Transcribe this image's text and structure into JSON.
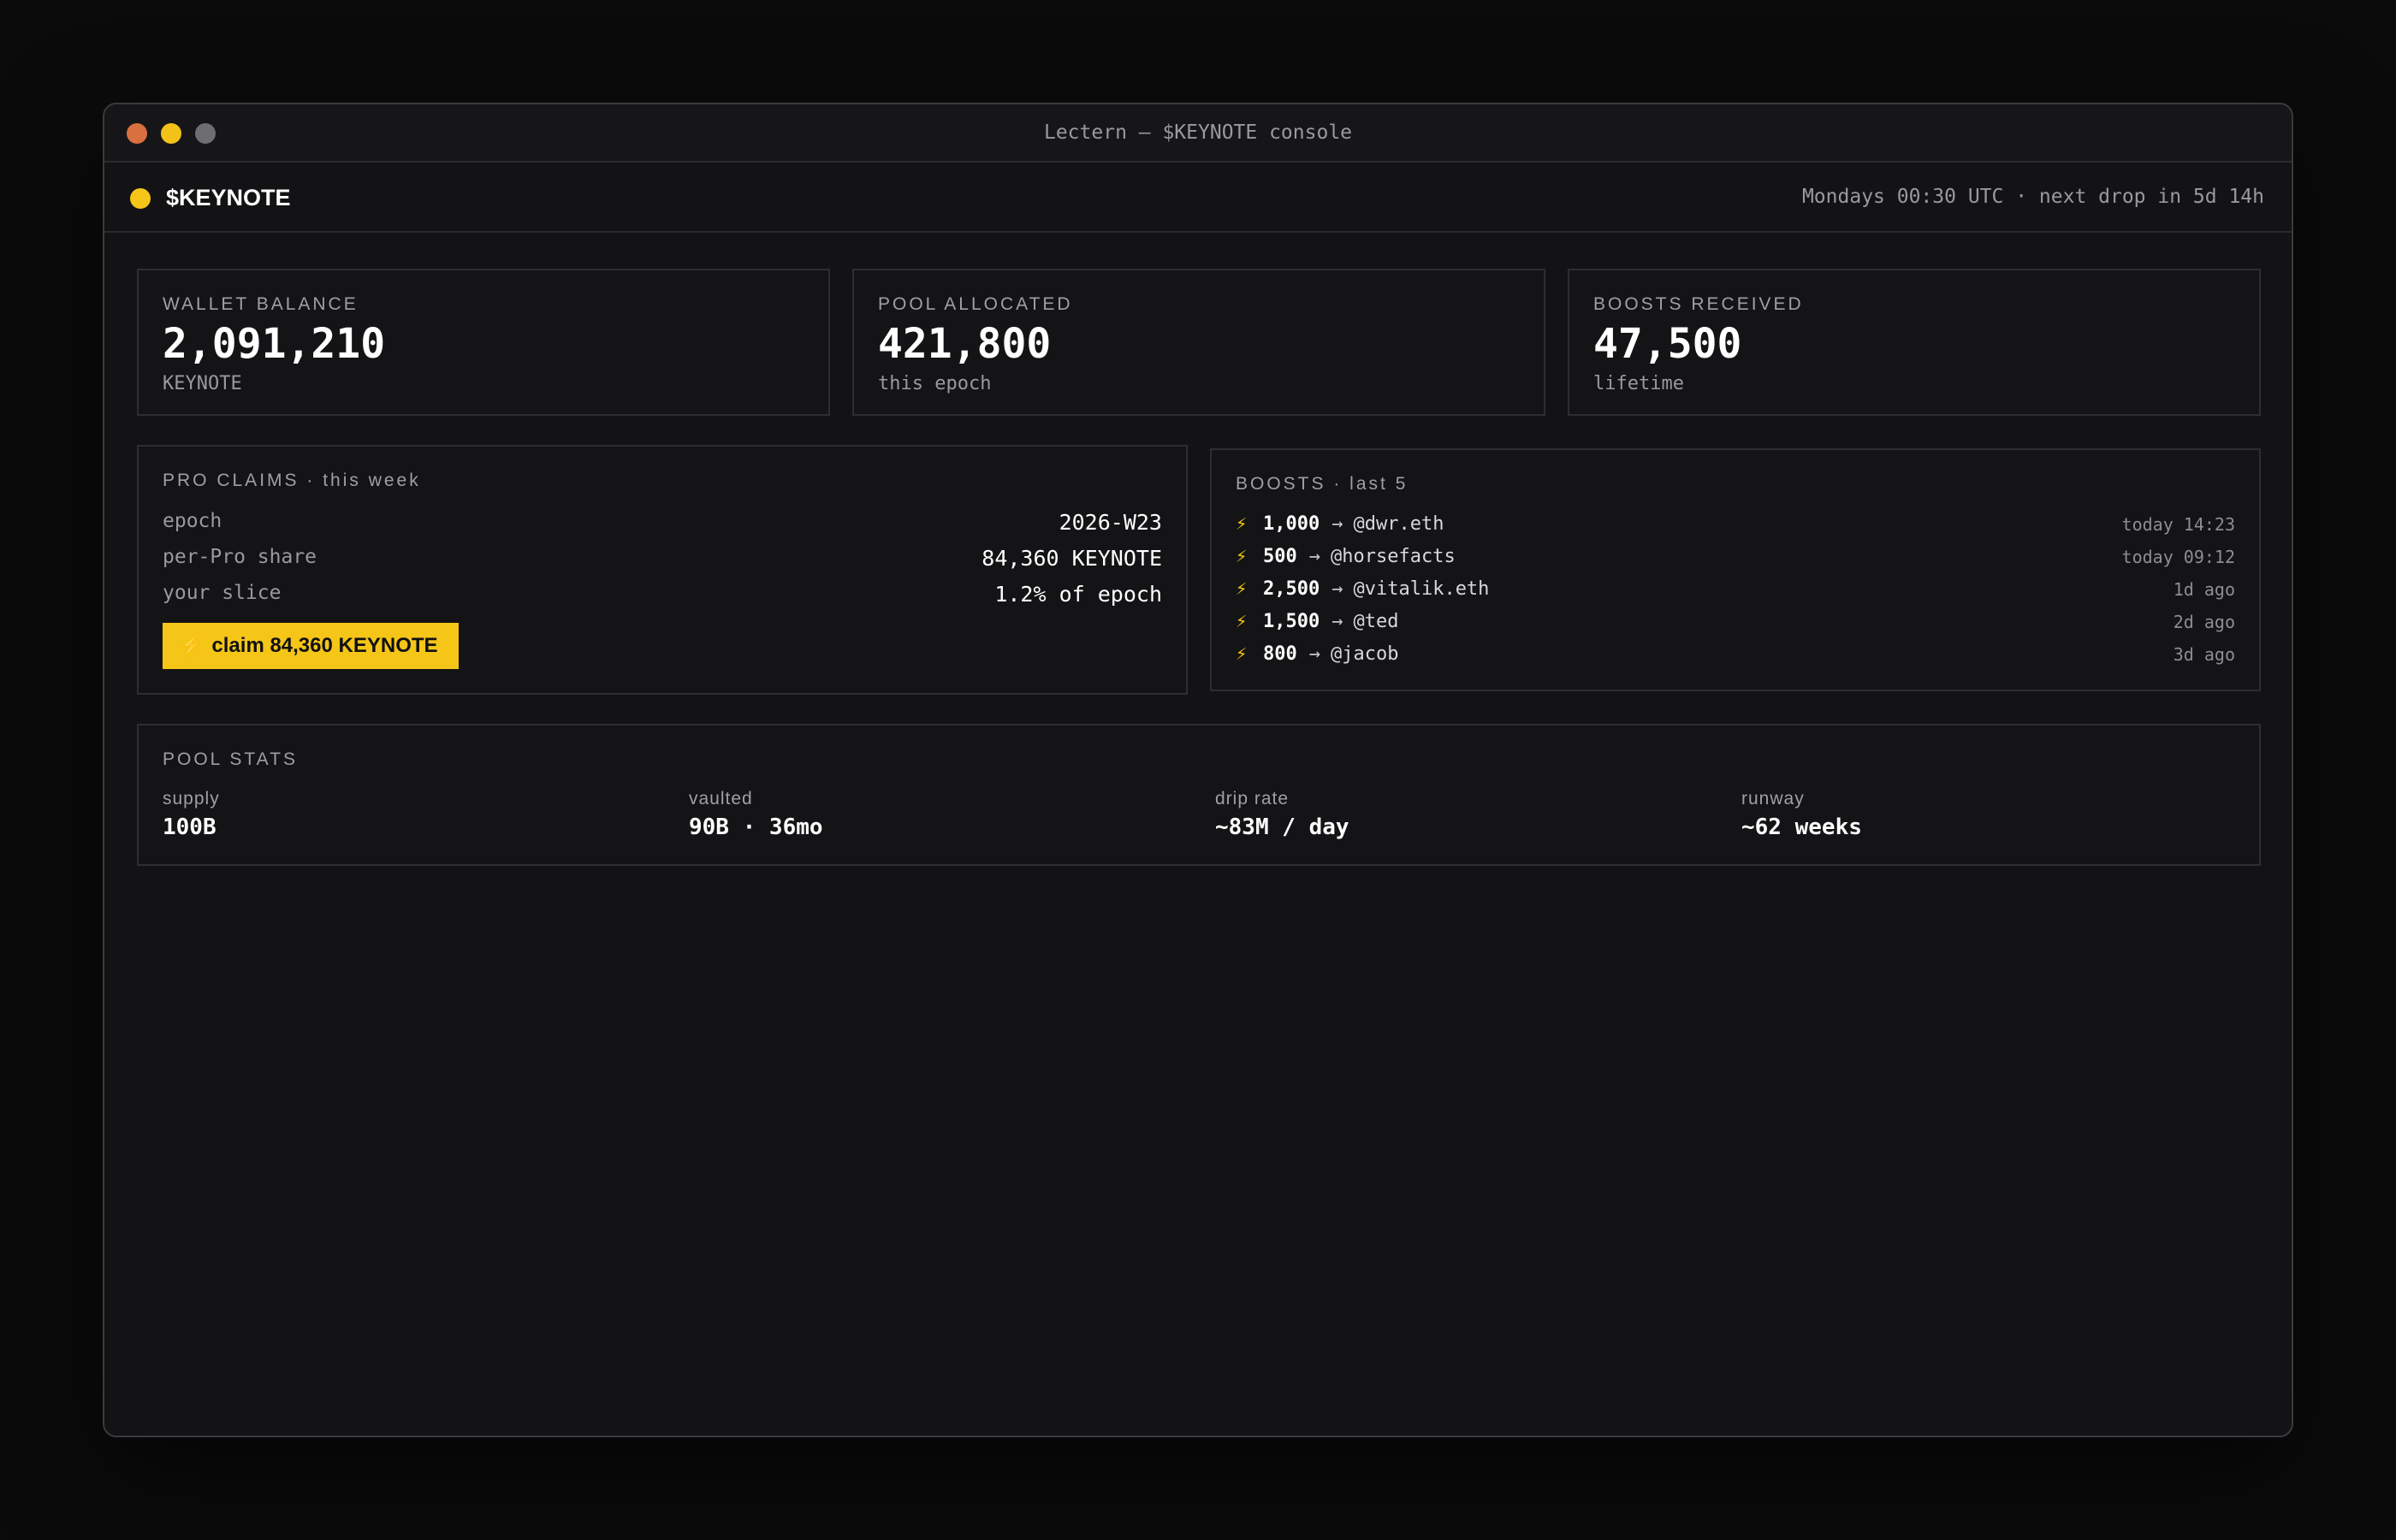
{
  "window": {
    "title": "Lectern — $KEYNOTE console"
  },
  "header": {
    "brand": "$KEYNOTE",
    "schedule": "Mondays 00:30 UTC · next drop in 5d 14h"
  },
  "stats": [
    {
      "label": "WALLET BALANCE",
      "value": "2,091,210",
      "sub": "KEYNOTE"
    },
    {
      "label": "POOL ALLOCATED",
      "value": "421,800",
      "sub": "this epoch"
    },
    {
      "label": "BOOSTS RECEIVED",
      "value": "47,500",
      "sub": "lifetime"
    }
  ],
  "claims": {
    "title": "PRO CLAIMS · this week",
    "rows": [
      {
        "key": "epoch",
        "value": "2026-W23"
      },
      {
        "key": "per-Pro share",
        "value": "84,360 KEYNOTE"
      },
      {
        "key": "your slice",
        "value": "1.2% of epoch"
      }
    ],
    "button_label": "claim 84,360 KEYNOTE"
  },
  "boosts": {
    "title": "BOOSTS · last 5",
    "items": [
      {
        "amount": "1,000",
        "handle": "@dwr.eth",
        "time": "today 14:23"
      },
      {
        "amount": "500",
        "handle": "@horsefacts",
        "time": "today 09:12"
      },
      {
        "amount": "2,500",
        "handle": "@vitalik.eth",
        "time": "1d ago"
      },
      {
        "amount": "1,500",
        "handle": "@ted",
        "time": "2d ago"
      },
      {
        "amount": "800",
        "handle": "@jacob",
        "time": "3d ago"
      }
    ]
  },
  "pool_stats": {
    "title": "POOL STATS",
    "items": [
      {
        "key": "supply",
        "value": "100B"
      },
      {
        "key": "vaulted",
        "value": "90B · 36mo"
      },
      {
        "key": "drip rate",
        "value": "~83M / day"
      },
      {
        "key": "runway",
        "value": "~62 weeks"
      }
    ]
  },
  "colors": {
    "accent": "#f5c518",
    "background": "#131315",
    "border": "#2e2e32",
    "traffic_red": "#d9703f",
    "traffic_yellow": "#f2c11a",
    "traffic_gray": "#6e6e72"
  },
  "icons": {
    "bolt": "lightning-bolt-icon",
    "arrow": "arrow-right-icon",
    "status_dot": "status-dot-icon"
  }
}
